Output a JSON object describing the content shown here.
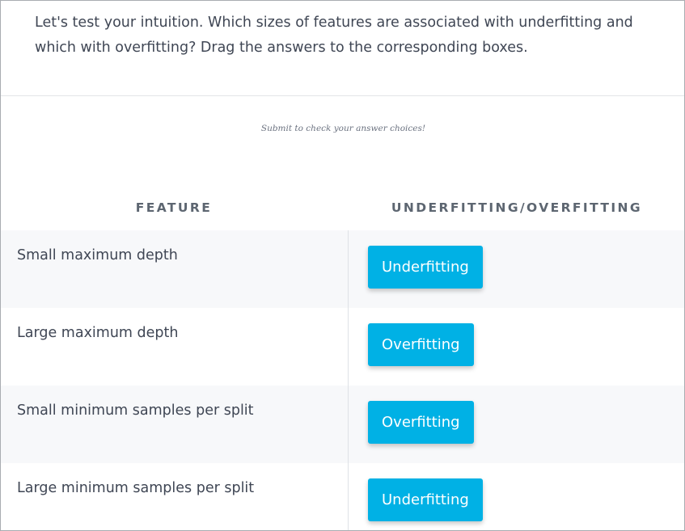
{
  "question": "Let's test your intuition. Which sizes of features are associated with underfitting and which with overfitting? Drag the answers to the corresponding boxes.",
  "hint": "Submit to check your answer choices!",
  "headers": {
    "feature": "FEATURE",
    "result": "UNDERFITTING/OVERFITTING"
  },
  "rows": [
    {
      "feature": "Small maximum depth",
      "answer": "Underfitting"
    },
    {
      "feature": "Large maximum depth",
      "answer": "Overfitting"
    },
    {
      "feature": "Small minimum samples per split",
      "answer": "Overfitting"
    },
    {
      "feature": "Large minimum samples per split",
      "answer": "Underfitting"
    }
  ],
  "colors": {
    "answer_chip": "#00b1e5",
    "row_shaded": "#f7f8fa"
  }
}
